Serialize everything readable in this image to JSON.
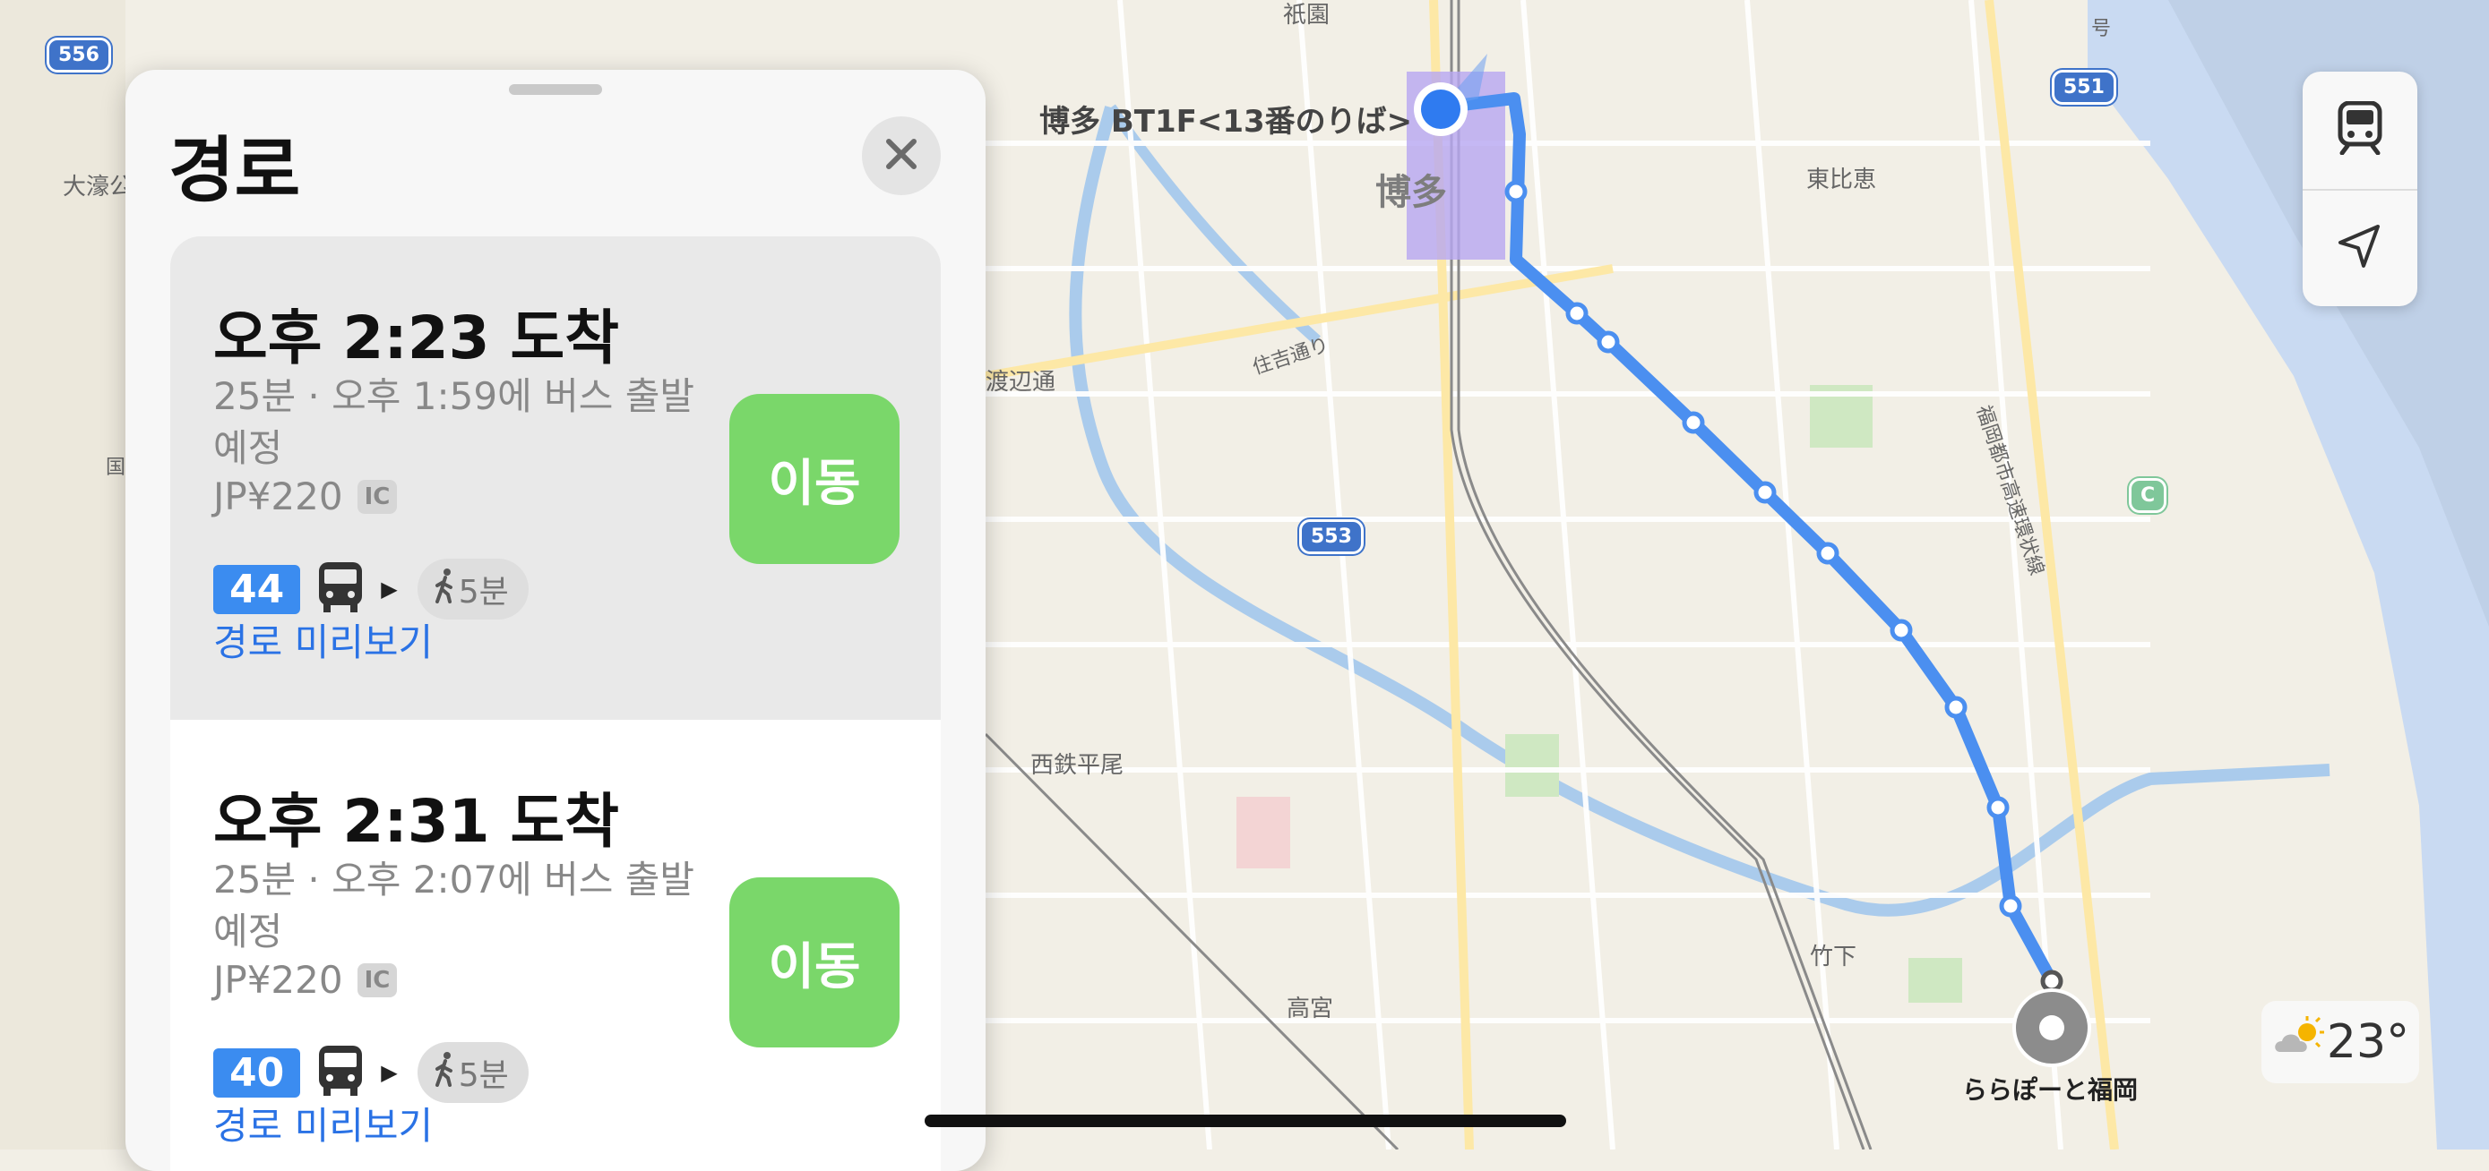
{
  "panel": {
    "title": "경로",
    "close_icon": "close-icon"
  },
  "routes": [
    {
      "arrival": "오후 2:23 도착",
      "summary": "25분 · 오후 1:59에 버스 출발 예정",
      "fare": "JP¥220",
      "ic_badge": "IC",
      "bus_number": "44",
      "walk": "5분",
      "preview_link": "경로 미리보기",
      "go_button": "이동"
    },
    {
      "arrival": "오후 2:31 도착",
      "summary": "25분 · 오후 2:07에 버스 출발 예정",
      "fare": "JP¥220",
      "ic_badge": "IC",
      "bus_number": "40",
      "walk": "5분",
      "preview_link": "경로 미리보기",
      "go_button": "이동"
    }
  ],
  "map": {
    "origin_label": "博多 BT1F<13番のりば>",
    "area_label": "博多",
    "destination_label": "ららぽーと福岡",
    "labels": [
      "祇園",
      "東比恵",
      "大濠公",
      "渡辺通",
      "住吉通り",
      "西鉄平尾",
      "竹下",
      "高宮",
      "福岡都市高速環状線",
      "国",
      "号"
    ],
    "shields": [
      "556",
      "551",
      "553",
      "C"
    ],
    "route_color": "#4b8ff0"
  },
  "controls": {
    "transit_icon": "train-icon",
    "location_icon": "location-arrow-icon"
  },
  "weather": {
    "temperature": "23°",
    "icon": "partly-sunny-icon"
  }
}
